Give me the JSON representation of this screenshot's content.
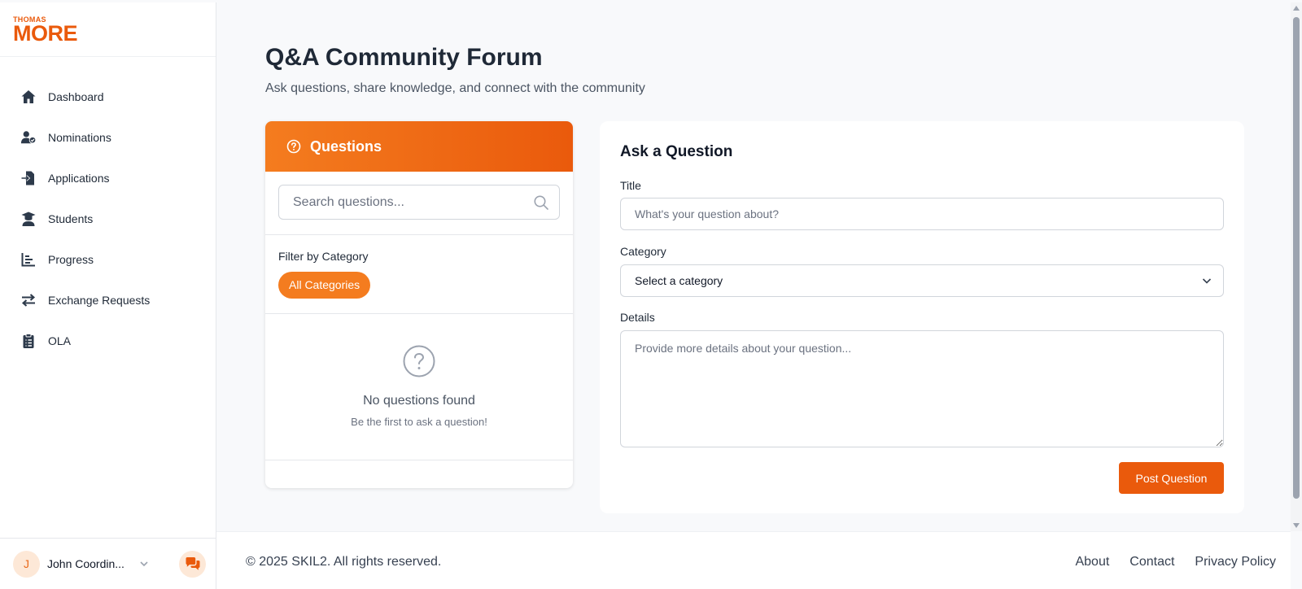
{
  "colors": {
    "brand": "#ea5a0c",
    "brand_light": "#f47c1f",
    "chip_bg": "#f47c1f",
    "avatar_bg": "#fde8d7"
  },
  "logo": {
    "top": "THOMAS",
    "bottom": "MORE"
  },
  "sidebar": {
    "items": [
      {
        "label": "Dashboard",
        "icon": "home-icon"
      },
      {
        "label": "Nominations",
        "icon": "user-check-icon"
      },
      {
        "label": "Applications",
        "icon": "file-import-icon"
      },
      {
        "label": "Students",
        "icon": "graduate-icon"
      },
      {
        "label": "Progress",
        "icon": "bar-chart-icon"
      },
      {
        "label": "Exchange Requests",
        "icon": "arrows-exchange-icon"
      },
      {
        "label": "OLA",
        "icon": "clipboard-icon"
      }
    ],
    "user": {
      "initial": "J",
      "name": "John Coordin..."
    }
  },
  "page": {
    "title": "Q&A Community Forum",
    "subtitle": "Ask questions, share knowledge, and connect with the community"
  },
  "questions_panel": {
    "title": "Questions",
    "search_placeholder": "Search questions...",
    "filter_label": "Filter by Category",
    "active_category": "All Categories",
    "empty_title": "No questions found",
    "empty_subtitle": "Be the first to ask a question!"
  },
  "ask_panel": {
    "title": "Ask a Question",
    "title_label": "Title",
    "title_placeholder": "What's your question about?",
    "category_label": "Category",
    "category_value": "Select a category",
    "details_label": "Details",
    "details_placeholder": "Provide more details about your question...",
    "submit_label": "Post Question"
  },
  "footer": {
    "copyright": "© 2025 SKIL2. All rights reserved.",
    "links": [
      "About",
      "Contact",
      "Privacy Policy"
    ]
  }
}
